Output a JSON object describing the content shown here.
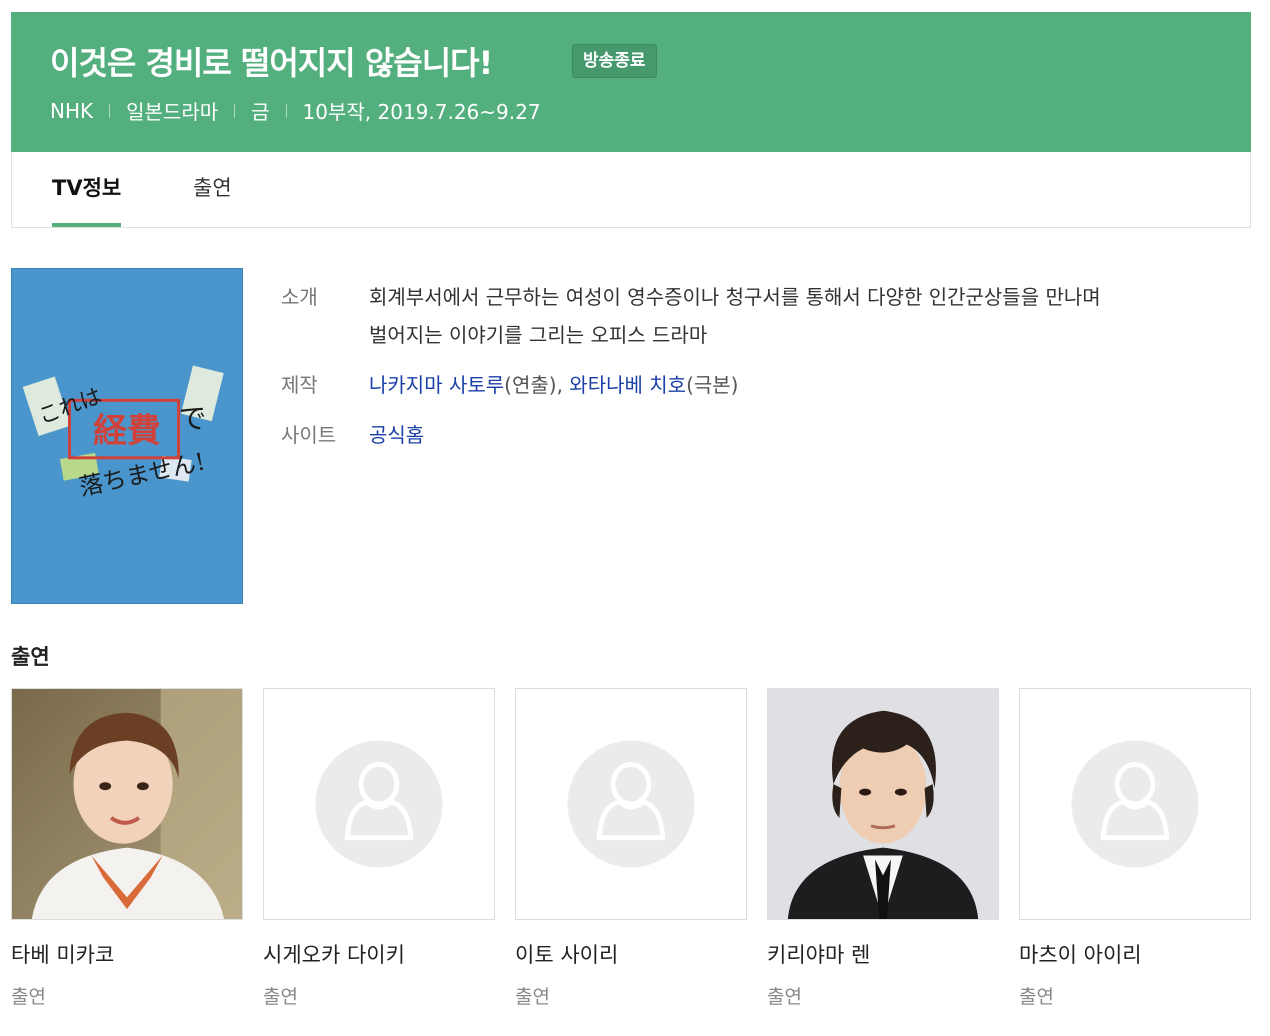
{
  "header": {
    "title": "이것은 경비로 떨어지지 않습니다!",
    "status_badge": "방송종료",
    "channel": "NHK",
    "genre": "일본드라마",
    "day": "금",
    "episodes": "10부작, 2019.7.26~9.27",
    "bg_color": "#53af7e"
  },
  "tabs": [
    {
      "label": "TV정보",
      "active": true
    },
    {
      "label": "출연",
      "active": false
    }
  ],
  "poster": {
    "title_text": "これは経費で落ちません!",
    "bg_color": "#4a96cc"
  },
  "info": {
    "intro_label": "소개",
    "intro_line1": "회계부서에서 근무하는 여성이 영수증이나 청구서를 통해서 다양한 인간군상들을 만나며",
    "intro_line2": "벌어지는 이야기를 그리는 오피스 드라마",
    "production_label": "제작",
    "director_name": "나카지마 사토루",
    "director_role": "(연출)",
    "separator": ", ",
    "writer_name": "와타나베 치호",
    "writer_role": "(극본)",
    "site_label": "사이트",
    "site_link": "공식홈"
  },
  "cast_section": {
    "title": "출연",
    "members": [
      {
        "name": "타베 미카코",
        "role": "출연",
        "photo": "photo"
      },
      {
        "name": "시게오카 다이키",
        "role": "출연",
        "photo": "placeholder"
      },
      {
        "name": "이토 사이리",
        "role": "출연",
        "photo": "placeholder"
      },
      {
        "name": "키리야마 렌",
        "role": "출연",
        "photo": "photo"
      },
      {
        "name": "마츠이 아이리",
        "role": "출연",
        "photo": "placeholder"
      }
    ]
  }
}
